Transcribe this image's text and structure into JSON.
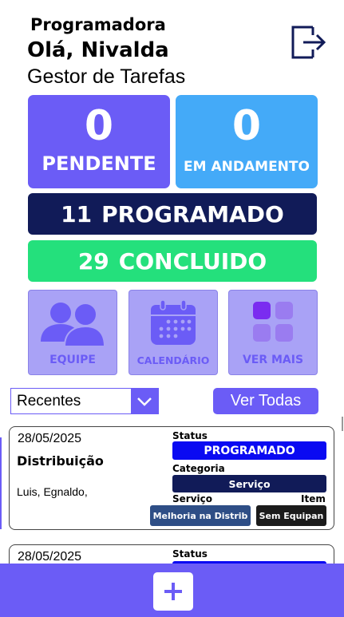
{
  "header": {
    "role": "Programadora",
    "greeting": "Olá, Nivalda",
    "subtitle": "Gestor de Tarefas"
  },
  "stats": {
    "pendente": {
      "count": "0",
      "label": "PENDENTE"
    },
    "andamento": {
      "count": "0",
      "label": "EM ANDAMENTO"
    },
    "programado": {
      "count": "11",
      "label": "PROGRAMADO"
    },
    "concluido": {
      "count": "29",
      "label": "CONCLUIDO"
    }
  },
  "tiles": {
    "equipe": "EQUIPE",
    "calendario": "CALENDÁRIO",
    "ver_mais": "VER MAIS"
  },
  "filter": {
    "selected": "Recentes",
    "ver_todas": "Ver Todas"
  },
  "tasks": [
    {
      "date": "28/05/2025",
      "title": "Distribuição",
      "people": "Luis, Egnaldo,",
      "status_label": "Status",
      "status": "PROGRAMADO",
      "category_label": "Categoria",
      "category": "Serviço",
      "service_label": "Serviço",
      "service": "Melhoria na Distrib",
      "item_label": "Item",
      "item": "Sem Equipan"
    },
    {
      "date": "28/05/2025",
      "status_label": "Status"
    }
  ],
  "colors": {
    "primary": "#6b5cf6",
    "pendente": "#6b5cf6",
    "andamento": "#44aaf8",
    "programado": "#111b58",
    "concluido": "#24e07c",
    "status_blue": "#0a0af2"
  },
  "icons": {
    "logout": "logout-icon",
    "team": "team-icon",
    "calendar": "calendar-icon",
    "more": "grid-icon",
    "dropdown": "chevron-down-icon",
    "add": "plus-icon"
  }
}
